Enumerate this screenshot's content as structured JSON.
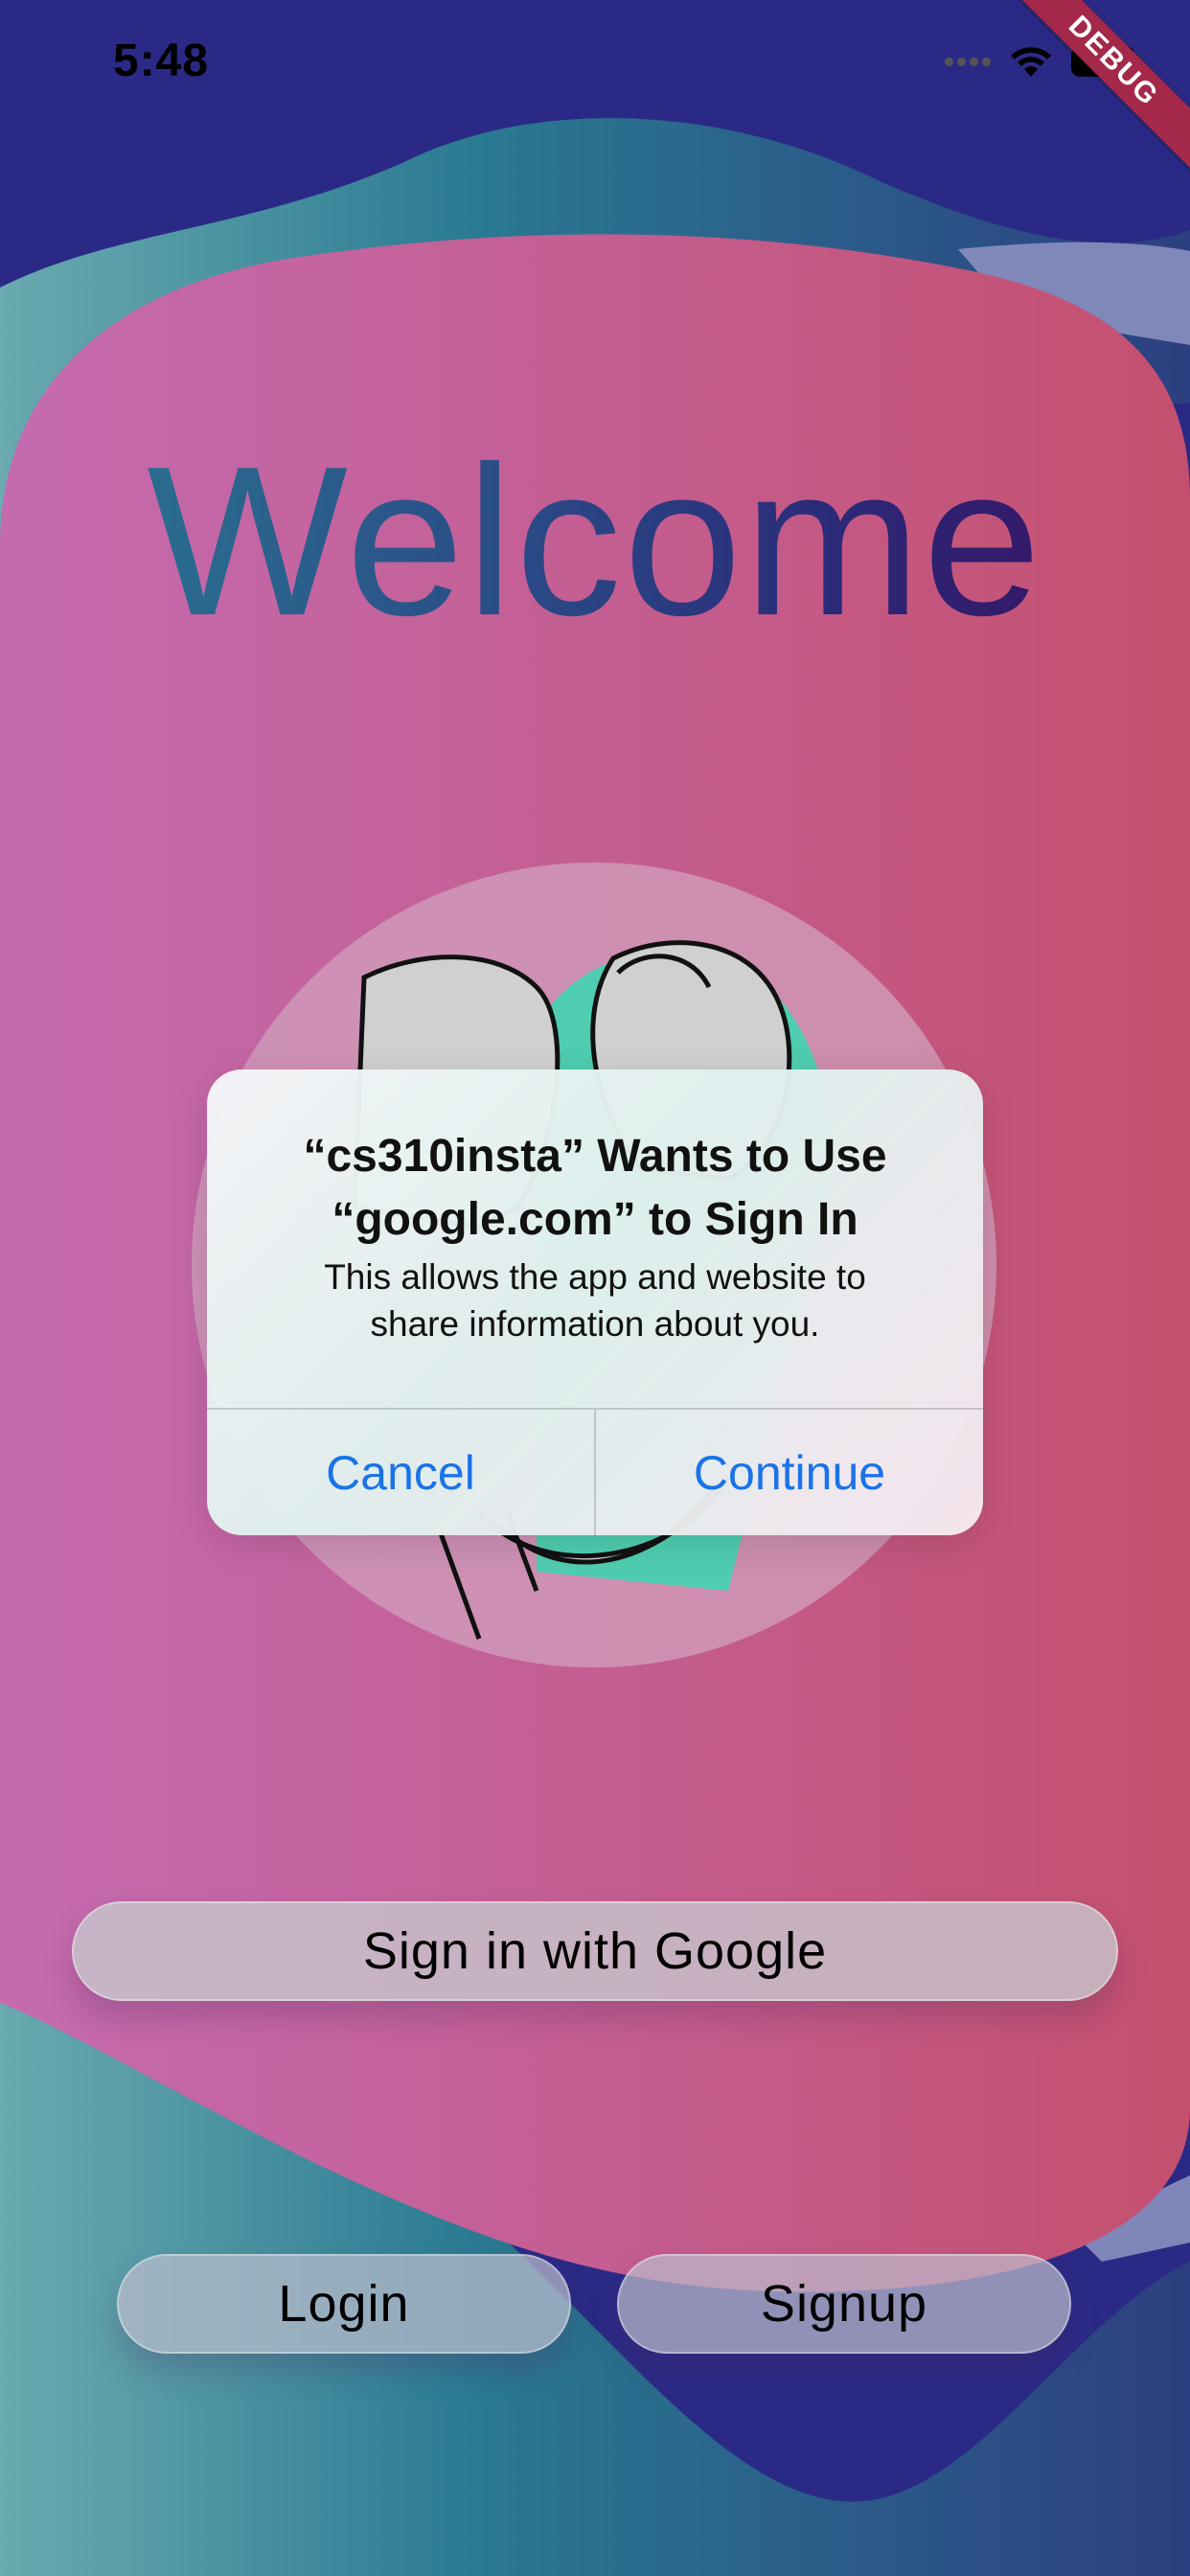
{
  "status_bar": {
    "time": "5:48",
    "icons": [
      "signal-icon",
      "wifi-icon",
      "battery-icon"
    ]
  },
  "debug_banner": "DEBUG",
  "welcome_title": "Welcome",
  "illustration": "couple-hugging-illustration",
  "buttons": {
    "google": "Sign in with Google",
    "login": "Login",
    "signup": "Signup"
  },
  "alert": {
    "title_line1": "“cs310insta” Wants to Use",
    "title_line2": "“google.com” to Sign In",
    "message_line1": "This allows the app and website to",
    "message_line2": "share information about you.",
    "cancel_label": "Cancel",
    "continue_label": "Continue"
  },
  "colors": {
    "background_navy": "#2a2a86",
    "blob_pink_left": "#c46bb0",
    "blob_pink_right": "#c4506e",
    "wave_teal": "#2a7a92",
    "accent_green": "#4fcdb0",
    "link_blue": "#1a73e8"
  }
}
